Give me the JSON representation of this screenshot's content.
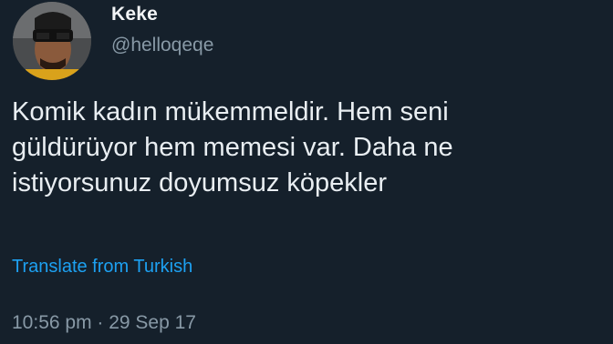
{
  "tweet": {
    "author_name": "Keke",
    "handle": "@helloqeqe",
    "text": "Komik kadın mükemmeldir. Hem seni\ngüldürüyor hem memesi var. Daha ne\nistiyorsunuz doyumsuz köpekler",
    "translate_label": "Translate from Turkish",
    "timestamp": "10:56 pm · 29 Sep 17"
  },
  "colors": {
    "background": "#15202b",
    "text": "#e9eef2",
    "secondary": "#8899a6",
    "link": "#1da1f2"
  }
}
